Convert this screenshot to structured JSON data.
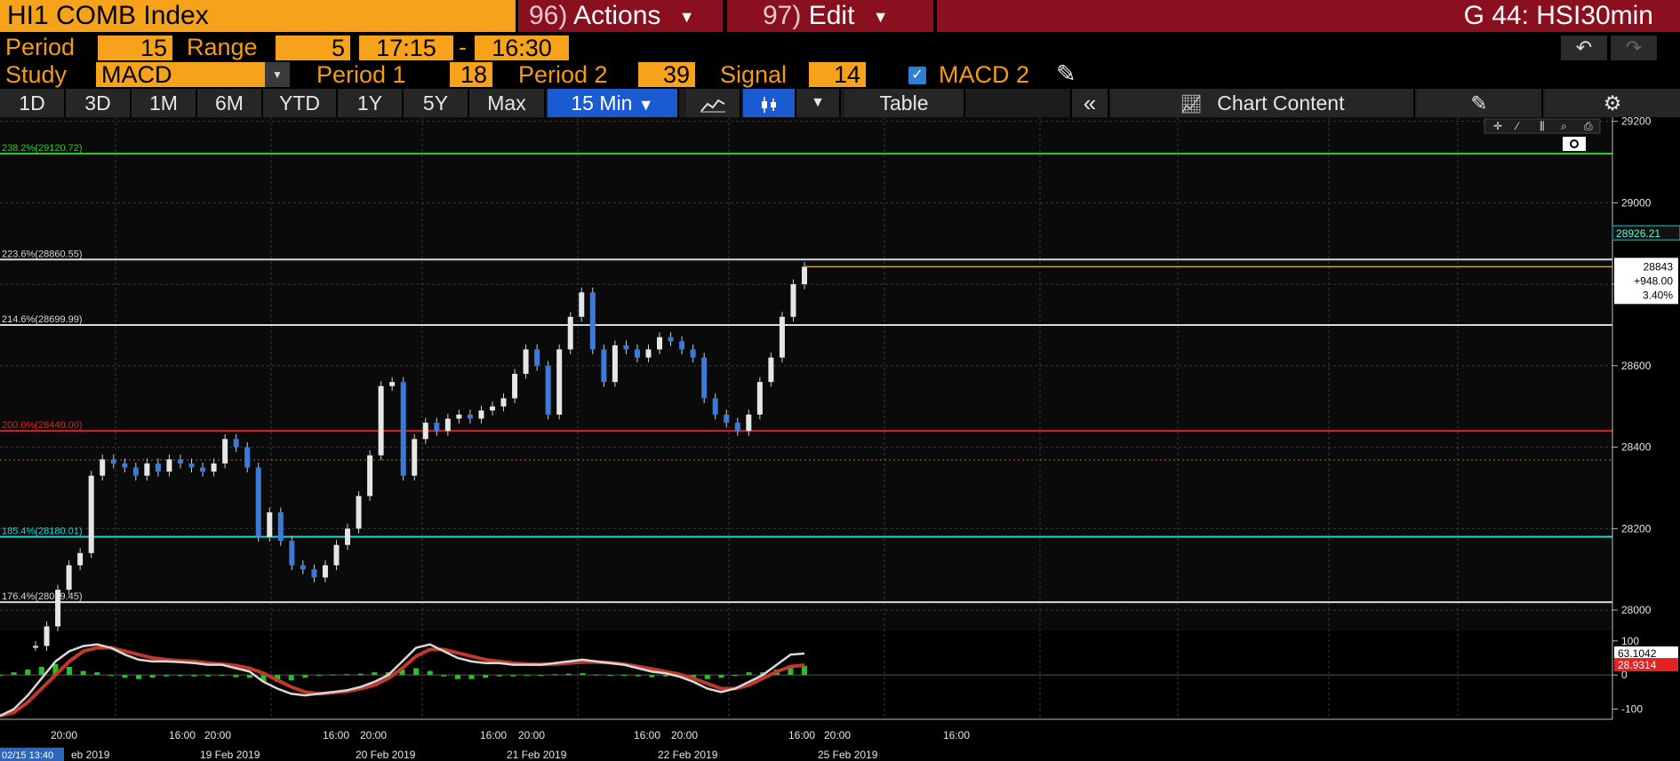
{
  "header": {
    "index_title": "HI1 COMB Index",
    "actions_num": "96)",
    "actions_label": "Actions",
    "edit_num": "97)",
    "edit_label": "Edit",
    "right_title": "G 44: HSI30min"
  },
  "params": {
    "period_label": "Period",
    "period_value": "15",
    "range_label": "Range",
    "range_value": "5",
    "time_from": "17:15",
    "time_sep": "-",
    "time_to": "16:30",
    "study_label": "Study",
    "study_value": "MACD",
    "period1_label": "Period 1",
    "period1_value": "18",
    "period2_label": "Period 2",
    "period2_value": "39",
    "signal_label": "Signal",
    "signal_value": "14",
    "macd2_label": "MACD 2"
  },
  "toolbar": {
    "ranges": [
      "1D",
      "3D",
      "1M",
      "6M",
      "YTD",
      "1Y",
      "5Y",
      "Max"
    ],
    "interval": "15 Min",
    "table_label": "Table",
    "chart_content_label": "Chart Content"
  },
  "chart_data": {
    "type": "line",
    "series": [
      {
        "values": [
          27912,
          27960,
          28050,
          28110,
          28140,
          28330,
          28370,
          28360,
          28350,
          28330,
          28360,
          28340,
          28370,
          28360,
          28350,
          28340,
          28360,
          28420,
          28400,
          28350,
          28180,
          28240,
          28170,
          28110,
          28100,
          28080,
          28110,
          28160,
          28200,
          28280,
          28380,
          28550,
          28560,
          28330,
          28420,
          28460,
          28440,
          28470,
          28480,
          28470,
          28490,
          28500,
          28520,
          28580,
          28640,
          28600,
          28480,
          28640,
          28720,
          28780,
          28640,
          28560,
          28650,
          28640,
          28620,
          28640,
          28670,
          28660,
          28640,
          28620,
          28520,
          28480,
          28460,
          28440,
          28480,
          28560,
          28620,
          28720,
          28800,
          28843
        ]
      }
    ],
    "y_axis": {
      "range": [
        27950,
        29210
      ],
      "ticks": [
        "29200",
        "29000",
        "28800",
        "28600",
        "28400",
        "28200",
        "28000"
      ]
    },
    "fib_levels": [
      {
        "label": "238.2%(29120.72)",
        "value": 29120.72,
        "color": "#22d11e"
      },
      {
        "label": "223.6%(28860.55)",
        "value": 28860.55,
        "color": "#d9d9d9"
      },
      {
        "label": "214.6%(28699.99)",
        "value": 28699.99,
        "color": "#d9d9d9"
      },
      {
        "label": "200.0%(28440.00)",
        "value": 28440.0,
        "color": "#e32222"
      },
      {
        "label": "185.4%(28180.01)",
        "value": 28180.01,
        "color": "#1fd6d6"
      },
      {
        "label": "176.4%(28019.45)",
        "value": 28019.45,
        "color": "#d9d9d9"
      }
    ],
    "price_labels": {
      "high_tag": "28926.21",
      "last": "28843",
      "change": "+948.00",
      "pct": "3.40%"
    },
    "x_ticks": [
      {
        "label": "20:00",
        "row": 1
      },
      {
        "label": "16:00",
        "row": 1
      },
      {
        "label": "20:00",
        "row": 1
      },
      {
        "label": "16:00",
        "row": 1
      },
      {
        "label": "20:00",
        "row": 1
      },
      {
        "label": "16:00",
        "row": 1
      },
      {
        "label": "20:00",
        "row": 1
      },
      {
        "label": "16:00",
        "row": 1
      },
      {
        "label": "20:00",
        "row": 1
      },
      {
        "label": "16:00",
        "row": 1
      },
      {
        "label": "20:00",
        "row": 1
      },
      {
        "label": "16:00",
        "row": 1
      }
    ],
    "x_dates": [
      "02/15 13:40",
      "eb 2019",
      "19 Feb 2019",
      "20 Feb 2019",
      "21 Feb 2019",
      "22 Feb 2019",
      "25 Feb 2019"
    ],
    "macd": {
      "ticks": [
        "100",
        "0",
        "-100"
      ],
      "range": [
        -130,
        110
      ],
      "macd_value": "63.1042",
      "signal_value": "28.9314",
      "macd_line": [
        -120,
        -100,
        -60,
        -10,
        40,
        70,
        85,
        90,
        80,
        60,
        45,
        40,
        40,
        38,
        35,
        30,
        30,
        20,
        10,
        -20,
        -40,
        -55,
        -60,
        -55,
        -50,
        -45,
        -35,
        -20,
        0,
        40,
        80,
        90,
        70,
        50,
        40,
        35,
        35,
        30,
        30,
        30,
        35,
        40,
        45,
        40,
        35,
        30,
        20,
        10,
        5,
        -5,
        -20,
        -40,
        -50,
        -40,
        -20,
        0,
        30,
        60,
        63
      ],
      "signal_line": [
        -120,
        -110,
        -80,
        -40,
        0,
        40,
        70,
        80,
        80,
        70,
        60,
        50,
        45,
        42,
        40,
        35,
        32,
        28,
        20,
        5,
        -15,
        -35,
        -50,
        -55,
        -52,
        -48,
        -40,
        -30,
        -10,
        20,
        55,
        75,
        75,
        65,
        55,
        45,
        40,
        35,
        32,
        31,
        32,
        35,
        38,
        38,
        36,
        32,
        25,
        18,
        10,
        2,
        -10,
        -25,
        -40,
        -40,
        -30,
        -10,
        10,
        25,
        29
      ]
    }
  },
  "colors": {
    "orange": "#f39c12",
    "orange_fill": "#f7a21b",
    "maroon": "#8a0f1f",
    "blue_active": "#1a5bd1",
    "grid": "#3a3a3a",
    "bg": "#000000"
  }
}
